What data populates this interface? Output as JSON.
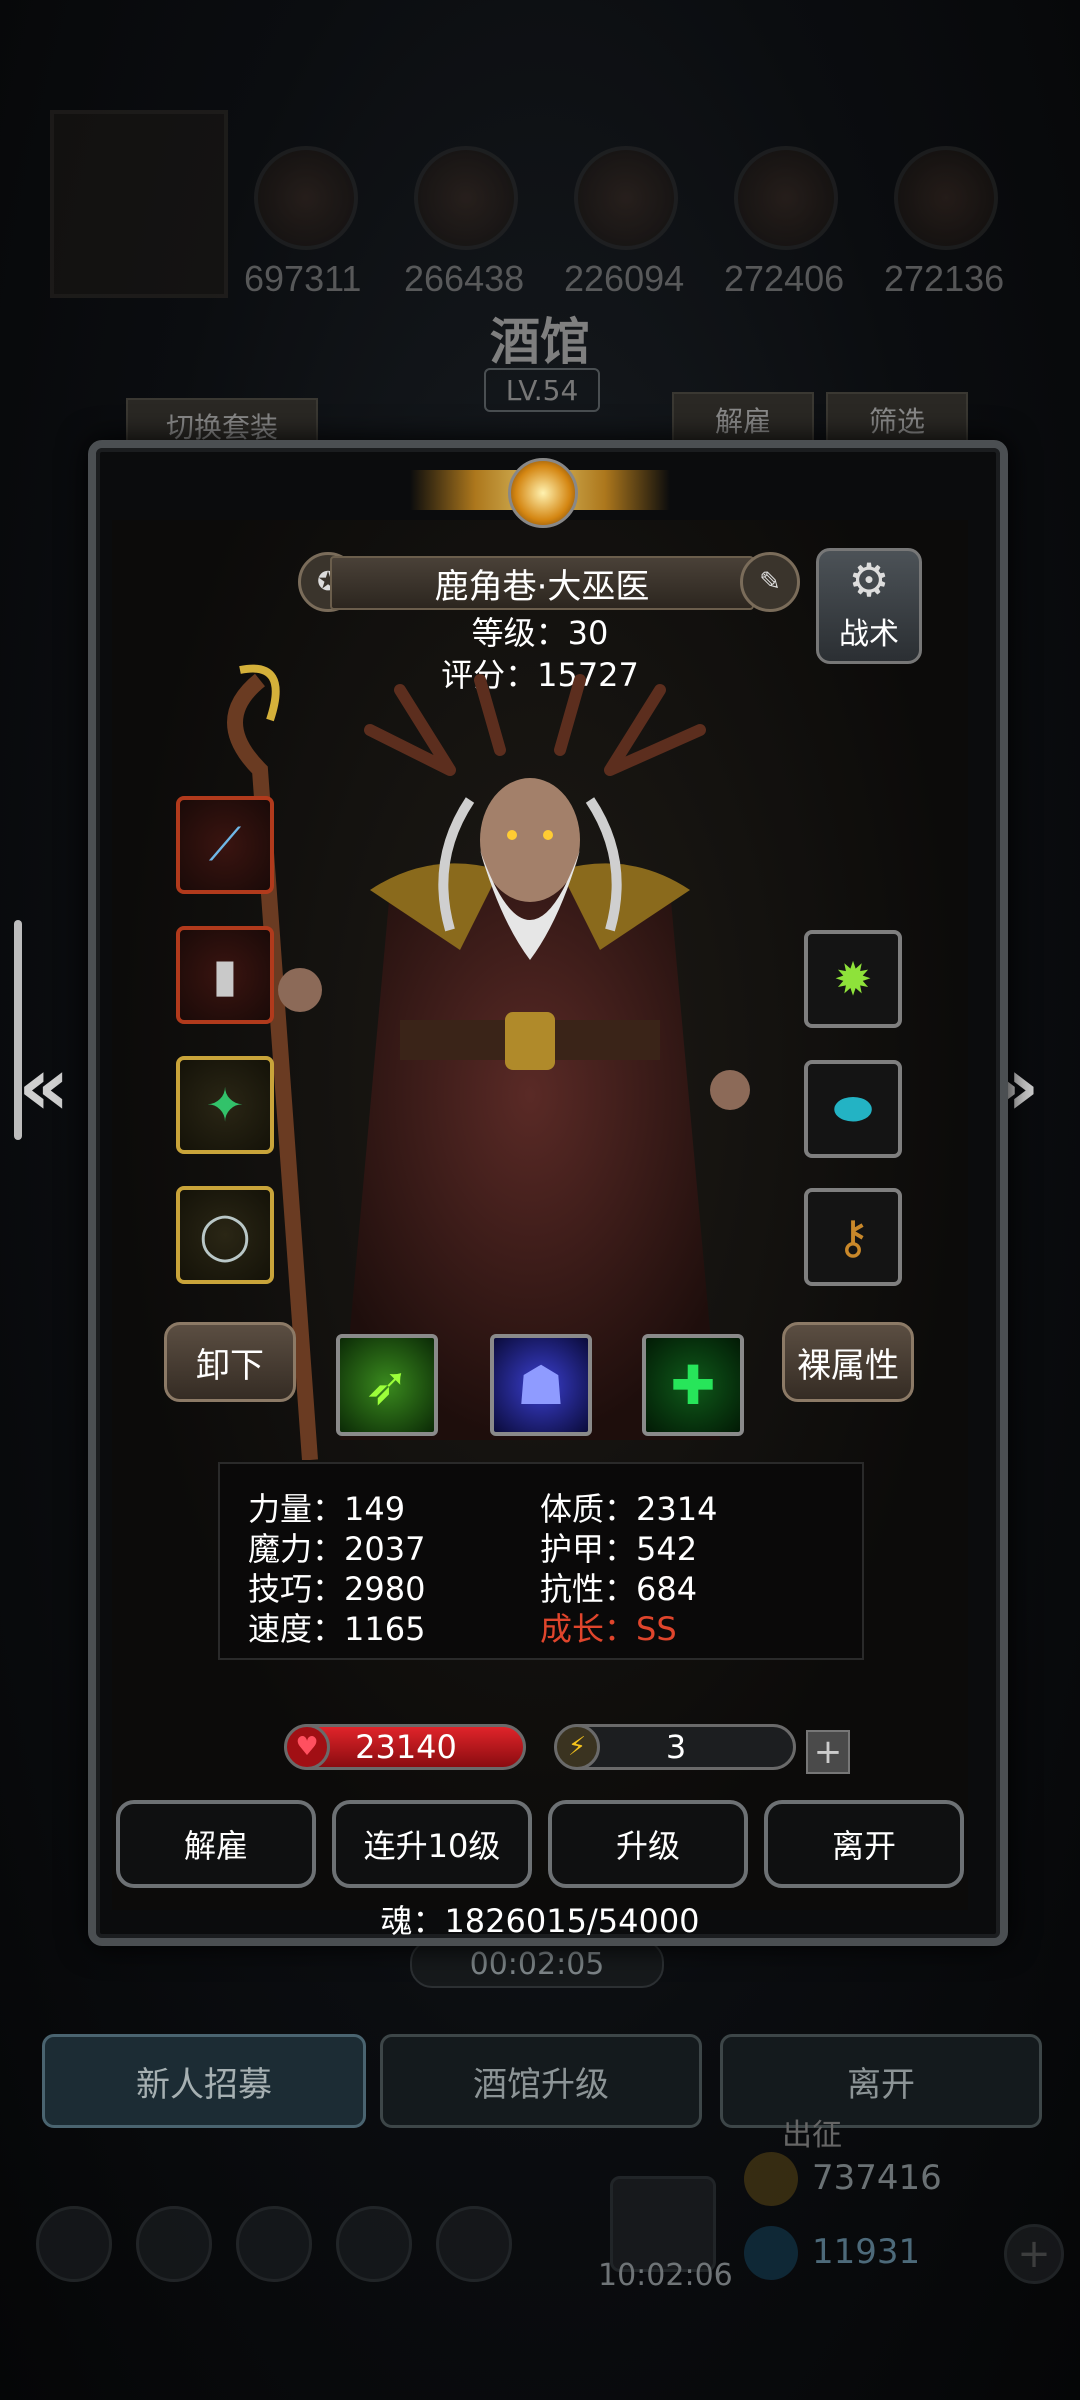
{
  "background": {
    "resources": [
      "697311",
      "266438",
      "226094",
      "272406",
      "272136"
    ],
    "title": "酒馆",
    "level": "LV.54",
    "switch_outfit": "切换套装",
    "dismiss": "解雇",
    "filter": "筛选",
    "timer": "00:02:05",
    "bottom_tabs": [
      "新人招募",
      "酒馆升级",
      "离开"
    ],
    "dock_label": "出征",
    "dock_time": "10:02:06",
    "currency_gold": "737416",
    "currency_gem": "11931"
  },
  "hero": {
    "name": "鹿角巷·大巫医",
    "level_line": "等级：30",
    "score_line": "评分：15727",
    "tactics_label": "战术",
    "unequip_label": "卸下",
    "base_attr_label": "裸属性"
  },
  "stats": {
    "left": [
      "力量：149",
      "魔力：2037",
      "技巧：2980",
      "速度：1165"
    ],
    "right": [
      "体质：2314",
      "护甲：542",
      "抗性：684"
    ],
    "growth": "成长：SS"
  },
  "bars": {
    "hp": "23140",
    "energy": "3",
    "plus": "+"
  },
  "actions": [
    "解雇",
    "连升10级",
    "升级",
    "离开"
  ],
  "soul_line": "魂：1826015/54000",
  "colors": {
    "hp": "#c0141a",
    "growth": "#e0452c",
    "energy": "#f3c21c"
  }
}
